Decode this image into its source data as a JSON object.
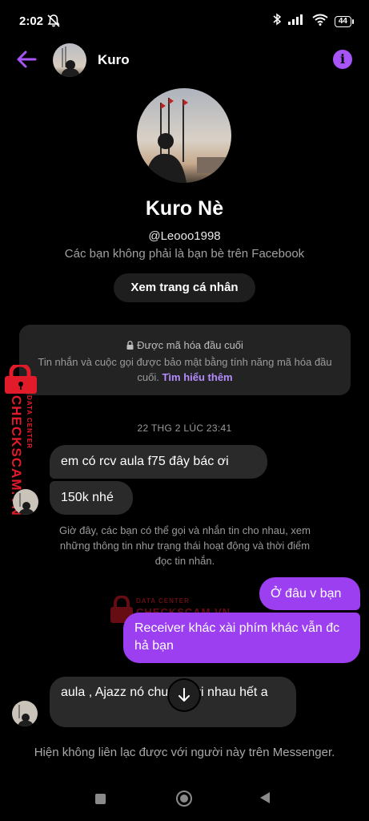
{
  "status_bar": {
    "time": "2:02",
    "battery": "44"
  },
  "header": {
    "name": "Kuro"
  },
  "profile": {
    "name": "Kuro Nè",
    "handle": "@Leooo1998",
    "friend_note": "Các bạn không phải là bạn bè trên Facebook",
    "view_profile_label": "Xem trang cá nhân"
  },
  "encryption": {
    "title": "Được mã hóa đầu cuối",
    "body": "Tin nhắn và cuộc gọi được bảo mật bằng tính năng mã hóa đầu cuối.",
    "link": "Tìm hiểu thêm"
  },
  "timestamp": "22 THG 2 LÚC 23:41",
  "messages": [
    {
      "direction": "in",
      "text": "em có rcv aula f75 đây bác ơi"
    },
    {
      "direction": "in",
      "text": "150k nhé"
    },
    {
      "direction": "out",
      "text": "Ở đâu v bạn"
    },
    {
      "direction": "out",
      "text": "Receiver khác xài phím khác vẫn đc hả bạn"
    },
    {
      "direction": "in",
      "text": "aula , Ajazz nó chung với nhau hết a"
    }
  ],
  "system_note": "Giờ đây, các bạn có thể gọi và nhắn tin cho nhau, xem những thông tin như trạng thái hoạt động và thời điểm đọc tin nhắn.",
  "footer_note": "Hiện không liên lạc được với người này trên Messenger.",
  "watermark": {
    "top": "DATA CENTER",
    "brand": "CHECKSCAM.VN"
  },
  "colors": {
    "accent": "#a855f7",
    "outgoing_bubble": "#9b3ff0",
    "incoming_bubble": "#2a2a2a",
    "watermark": "#e21b2a"
  },
  "icons": [
    "back-arrow-icon",
    "info-icon",
    "lock-icon",
    "chevron-down-icon",
    "mute-icon",
    "bluetooth-icon",
    "signal-icon",
    "wifi-icon",
    "battery-icon"
  ]
}
